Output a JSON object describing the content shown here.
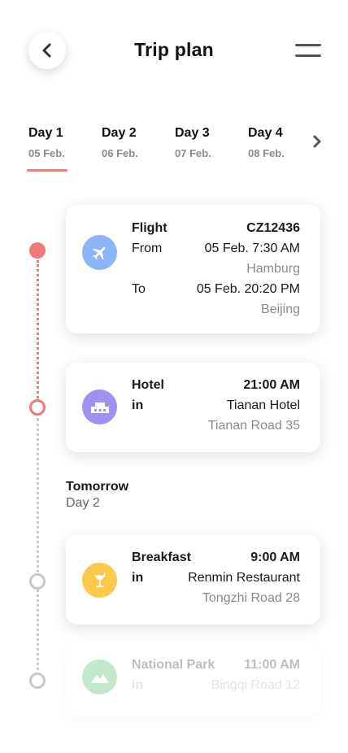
{
  "header": {
    "title": "Trip plan",
    "back_icon": "chevron-left-icon",
    "menu_icon": "hamburger-menu-icon"
  },
  "days": [
    {
      "label": "Day 1",
      "date": "05 Feb."
    },
    {
      "label": "Day 2",
      "date": "06 Feb."
    },
    {
      "label": "Day 3",
      "date": "07 Feb."
    },
    {
      "label": "Day 4",
      "date": "08 Feb."
    }
  ],
  "active_day_index": 0,
  "colors": {
    "accent": "#f0797c",
    "flight_icon_bg": "#8ab6f9",
    "hotel_icon_bg": "#a18ff2",
    "breakfast_icon_bg": "#fcc94a",
    "park_icon_bg": "#8fd7a1"
  },
  "flight": {
    "icon": "airplane-icon",
    "label": "Flight",
    "number": "CZ12436",
    "from_label": "From",
    "from_time": "05 Feb. 7:30 AM",
    "from_city": "Hamburg",
    "to_label": "To",
    "to_time": "05 Feb. 20:20 PM",
    "to_city": "Beijing"
  },
  "hotel": {
    "icon": "hotel-icon",
    "label": "Hotel",
    "time": "21:00 AM",
    "in_label": "in",
    "name": "Tianan Hotel",
    "address": "Tianan Road 35"
  },
  "tomorrow": {
    "title": "Tomorrow",
    "day": "Day 2"
  },
  "breakfast": {
    "icon": "cocktail-icon",
    "label": "Breakfast",
    "time": "9:00 AM",
    "in_label": "in",
    "name": "Renmin Restaurant",
    "address": "Tongzhi Road 28"
  },
  "park": {
    "icon": "mountain-icon",
    "label": "National Park",
    "time": "11:00 AM",
    "in_label": "in",
    "address": "Bingqi Road 12"
  }
}
